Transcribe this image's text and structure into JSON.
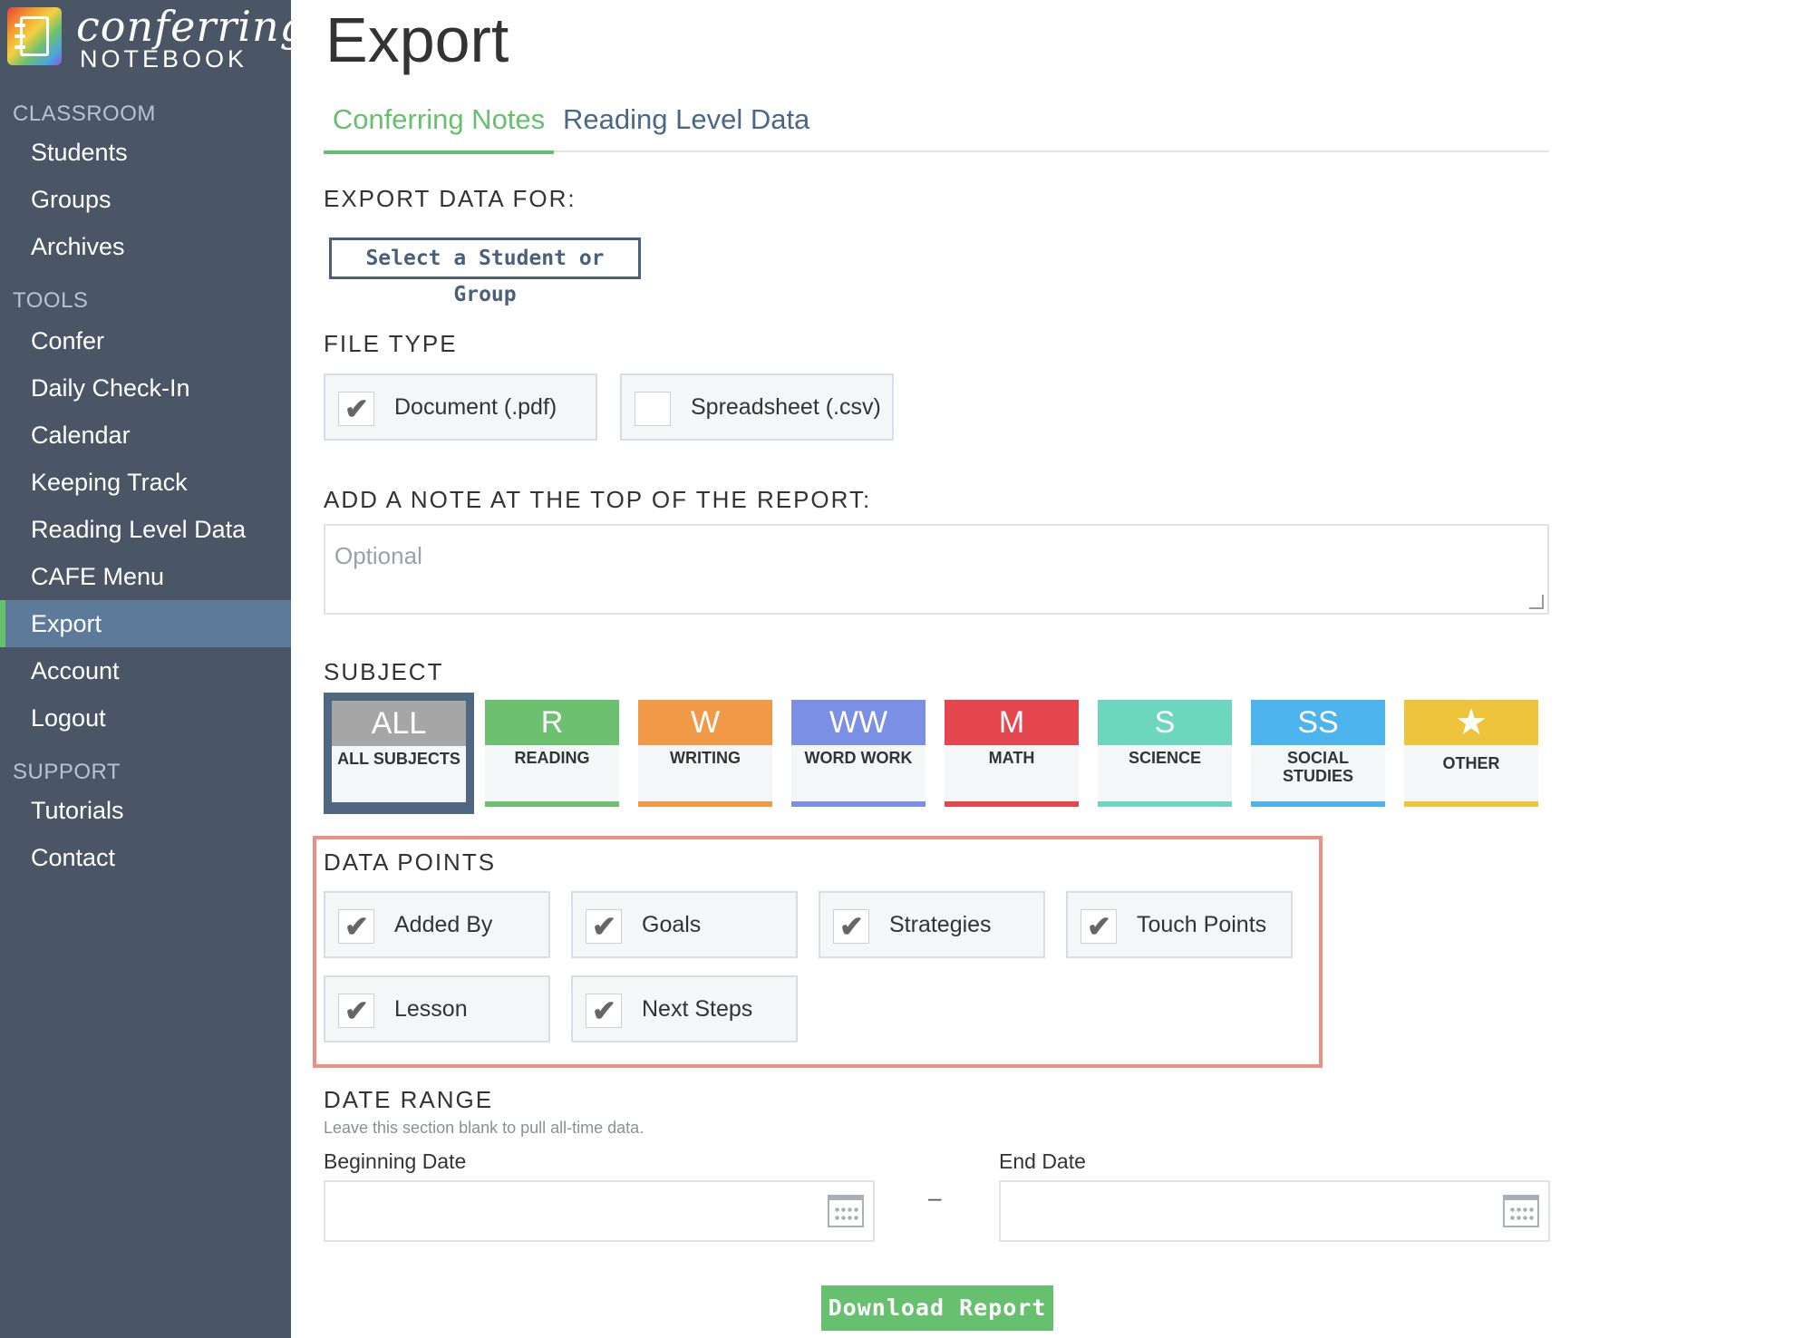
{
  "app": {
    "logo_line1": "conferring",
    "logo_line2": "NOTEBOOK"
  },
  "sidebar": {
    "sections": [
      {
        "title": "CLASSROOM",
        "items": [
          "Students",
          "Groups",
          "Archives"
        ]
      },
      {
        "title": "TOOLS",
        "items": [
          "Confer",
          "Daily Check-In",
          "Calendar",
          "Keeping Track",
          "Reading Level Data",
          "CAFE Menu",
          "Export",
          "Account",
          "Logout"
        ]
      },
      {
        "title": "SUPPORT",
        "items": [
          "Tutorials",
          "Contact"
        ]
      }
    ],
    "active_item": "Export"
  },
  "page": {
    "title": "Export",
    "tabs": [
      {
        "label": "Conferring Notes",
        "active": true
      },
      {
        "label": "Reading Level Data",
        "active": false
      }
    ]
  },
  "export_for": {
    "label": "EXPORT DATA FOR:",
    "button": "Select a Student or Group"
  },
  "file_type": {
    "label": "FILE TYPE",
    "options": [
      {
        "label": "Document (.pdf)",
        "checked": true
      },
      {
        "label": "Spreadsheet (.csv)",
        "checked": false
      }
    ]
  },
  "note": {
    "label": "ADD A NOTE AT THE TOP OF THE REPORT:",
    "placeholder": "Optional"
  },
  "subject": {
    "label": "SUBJECT",
    "items": [
      {
        "code": "ALL",
        "name": "ALL SUBJECTS",
        "color": "#a6a6a6",
        "selected": true
      },
      {
        "code": "R",
        "name": "READING",
        "color": "#6cc070"
      },
      {
        "code": "W",
        "name": "WRITING",
        "color": "#f09a48"
      },
      {
        "code": "WW",
        "name": "WORD WORK",
        "color": "#7b8fe4"
      },
      {
        "code": "M",
        "name": "MATH",
        "color": "#e5474f"
      },
      {
        "code": "S",
        "name": "SCIENCE",
        "color": "#6dd6bf"
      },
      {
        "code": "SS",
        "name": "SOCIAL STUDIES",
        "color": "#4cb3ec"
      },
      {
        "code": "star-icon",
        "name": "OTHER",
        "color": "#eec43d"
      }
    ]
  },
  "data_points": {
    "label": "DATA POINTS",
    "options": [
      {
        "label": "Added By",
        "checked": true
      },
      {
        "label": "Goals",
        "checked": true
      },
      {
        "label": "Strategies",
        "checked": true
      },
      {
        "label": "Touch Points",
        "checked": true
      },
      {
        "label": "Lesson",
        "checked": true
      },
      {
        "label": "Next Steps",
        "checked": true
      }
    ]
  },
  "date_range": {
    "label": "DATE RANGE",
    "hint": "Leave this section blank to pull all-time data.",
    "begin_label": "Beginning Date",
    "end_label": "End Date",
    "separator": "–"
  },
  "download_button": "Download Report",
  "colors": {
    "sidebar": "#4a5666",
    "accent_green": "#66c06e",
    "tab_blue": "#4a6788",
    "highlight": "#ec8f86"
  }
}
